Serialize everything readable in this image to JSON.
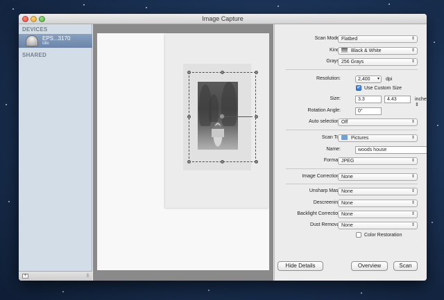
{
  "window": {
    "title": "Image Capture"
  },
  "sidebar": {
    "devices_header": "DEVICES",
    "device": {
      "name": "EPS...3170",
      "sub": "Idle"
    },
    "shared_header": "SHARED"
  },
  "settings": {
    "scan_mode": {
      "label": "Scan Mode:",
      "value": "Flatbed"
    },
    "kind": {
      "label": "Kind:",
      "value": "Black & White"
    },
    "grays": {
      "label": "Grays:",
      "value": "256 Grays"
    },
    "resolution": {
      "label": "Resolution:",
      "value": "2,400",
      "unit": "dpi"
    },
    "use_custom_size": {
      "label": "Use Custom Size",
      "checked": true
    },
    "size": {
      "label": "Size:",
      "width": "3.3",
      "height": "4.43",
      "unit": "inches"
    },
    "rotation": {
      "label": "Rotation Angle:",
      "value": "0°"
    },
    "auto_selection": {
      "label": "Auto selection:",
      "value": "Off"
    },
    "scan_to": {
      "label": "Scan To:",
      "value": "Pictures"
    },
    "name": {
      "label": "Name:",
      "value": "woods house"
    },
    "format": {
      "label": "Format:",
      "value": "JPEG"
    },
    "image_correction": {
      "label": "Image Correction:",
      "value": "None"
    },
    "unsharp_mask": {
      "label": "Unsharp Mask",
      "value": "None"
    },
    "descreening": {
      "label": "Descreening",
      "value": "None"
    },
    "backlight_correction": {
      "label": "Backlight Correction",
      "value": "None"
    },
    "dust_removal": {
      "label": "Dust Removal",
      "value": "None"
    },
    "color_restoration": {
      "label": "Color Restoration",
      "checked": false
    }
  },
  "buttons": {
    "hide_details": "Hide Details",
    "overview": "Overview",
    "scan": "Scan"
  },
  "icons": {
    "popup_arrows": "⇕",
    "resolution_arrow": "▾",
    "check": "✓",
    "add": "+",
    "grip": "⦀"
  }
}
